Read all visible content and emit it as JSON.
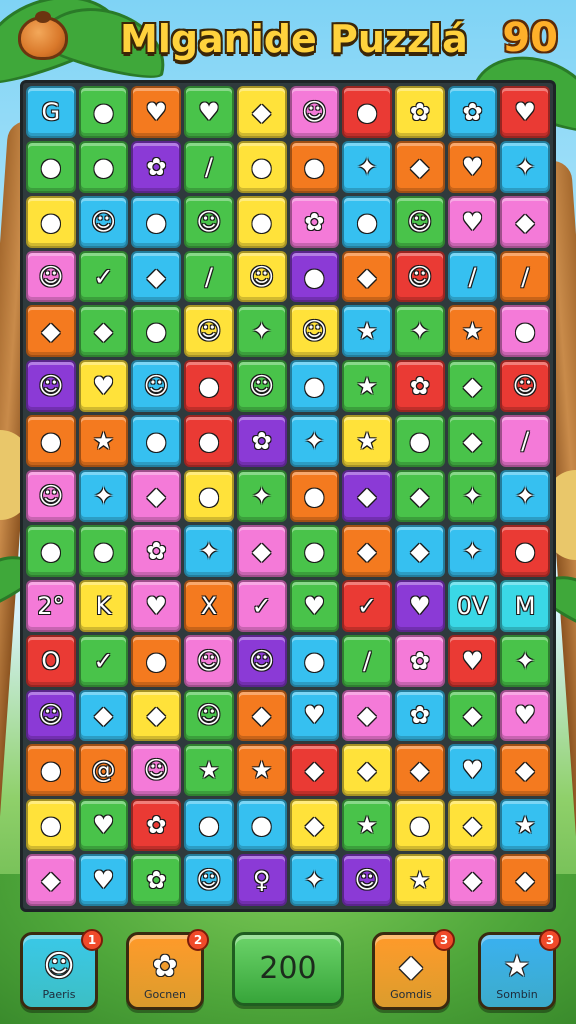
{
  "header": {
    "title": "Mlganide Puzzlá",
    "score": "90",
    "coconut_icon": "coconut-icon"
  },
  "palette": {
    "blue": "#36c0f0",
    "green": "#49c34a",
    "red": "#ea3a34",
    "orange": "#f47a1f",
    "yellow": "#ffe23a",
    "pink": "#f47ad8",
    "purple": "#8b3ad6",
    "magenta": "#e64ac8",
    "cyan": "#3ad8e6"
  },
  "board": {
    "rows": [
      [
        {
          "c": "blue",
          "g": "G"
        },
        {
          "c": "green",
          "g": "●"
        },
        {
          "c": "orange",
          "g": "♥"
        },
        {
          "c": "green",
          "g": "♥"
        },
        {
          "c": "yellow",
          "g": "◆"
        },
        {
          "c": "pink",
          "g": "☺"
        },
        {
          "c": "red",
          "g": "●"
        },
        {
          "c": "yellow",
          "g": "✿"
        },
        {
          "c": "blue",
          "g": "✿"
        },
        {
          "c": "red",
          "g": "♥"
        }
      ],
      [
        {
          "c": "green",
          "g": "●"
        },
        {
          "c": "green",
          "g": "●"
        },
        {
          "c": "purple",
          "g": "✿"
        },
        {
          "c": "green",
          "g": "/"
        },
        {
          "c": "yellow",
          "g": "●"
        },
        {
          "c": "orange",
          "g": "●"
        },
        {
          "c": "blue",
          "g": "✦"
        },
        {
          "c": "orange",
          "g": "◆"
        },
        {
          "c": "orange",
          "g": "♥"
        },
        {
          "c": "blue",
          "g": "✦"
        }
      ],
      [
        {
          "c": "yellow",
          "g": "●"
        },
        {
          "c": "blue",
          "g": "☺"
        },
        {
          "c": "blue",
          "g": "●"
        },
        {
          "c": "green",
          "g": "☺"
        },
        {
          "c": "yellow",
          "g": "●"
        },
        {
          "c": "pink",
          "g": "✿"
        },
        {
          "c": "blue",
          "g": "●"
        },
        {
          "c": "green",
          "g": "☺"
        },
        {
          "c": "pink",
          "g": "♥"
        },
        {
          "c": "pink",
          "g": "◆"
        }
      ],
      [
        {
          "c": "pink",
          "g": "☺"
        },
        {
          "c": "green",
          "g": "✓"
        },
        {
          "c": "blue",
          "g": "◆"
        },
        {
          "c": "green",
          "g": "/"
        },
        {
          "c": "yellow",
          "g": "☺"
        },
        {
          "c": "purple",
          "g": "●"
        },
        {
          "c": "orange",
          "g": "◆"
        },
        {
          "c": "red",
          "g": "☺"
        },
        {
          "c": "blue",
          "g": "/"
        },
        {
          "c": "orange",
          "g": "/"
        }
      ],
      [
        {
          "c": "orange",
          "g": "◆"
        },
        {
          "c": "green",
          "g": "◆"
        },
        {
          "c": "green",
          "g": "●"
        },
        {
          "c": "yellow",
          "g": "☺"
        },
        {
          "c": "green",
          "g": "✦"
        },
        {
          "c": "yellow",
          "g": "☺"
        },
        {
          "c": "blue",
          "g": "★"
        },
        {
          "c": "green",
          "g": "✦"
        },
        {
          "c": "orange",
          "g": "★"
        },
        {
          "c": "pink",
          "g": "●"
        }
      ],
      [
        {
          "c": "purple",
          "g": "☺"
        },
        {
          "c": "yellow",
          "g": "♥"
        },
        {
          "c": "blue",
          "g": "☺"
        },
        {
          "c": "red",
          "g": "●"
        },
        {
          "c": "green",
          "g": "☺"
        },
        {
          "c": "blue",
          "g": "●"
        },
        {
          "c": "green",
          "g": "★"
        },
        {
          "c": "red",
          "g": "✿"
        },
        {
          "c": "green",
          "g": "◆"
        },
        {
          "c": "red",
          "g": "☺"
        }
      ],
      [
        {
          "c": "orange",
          "g": "●"
        },
        {
          "c": "orange",
          "g": "★"
        },
        {
          "c": "blue",
          "g": "●"
        },
        {
          "c": "red",
          "g": "●"
        },
        {
          "c": "purple",
          "g": "✿"
        },
        {
          "c": "blue",
          "g": "✦"
        },
        {
          "c": "yellow",
          "g": "★"
        },
        {
          "c": "green",
          "g": "●"
        },
        {
          "c": "green",
          "g": "◆"
        },
        {
          "c": "pink",
          "g": "/"
        }
      ],
      [
        {
          "c": "pink",
          "g": "☺"
        },
        {
          "c": "blue",
          "g": "✦"
        },
        {
          "c": "pink",
          "g": "◆"
        },
        {
          "c": "yellow",
          "g": "●"
        },
        {
          "c": "green",
          "g": "✦"
        },
        {
          "c": "orange",
          "g": "●"
        },
        {
          "c": "purple",
          "g": "◆"
        },
        {
          "c": "green",
          "g": "◆"
        },
        {
          "c": "green",
          "g": "✦"
        },
        {
          "c": "blue",
          "g": "✦"
        }
      ],
      [
        {
          "c": "green",
          "g": "●"
        },
        {
          "c": "green",
          "g": "●"
        },
        {
          "c": "pink",
          "g": "✿"
        },
        {
          "c": "blue",
          "g": "✦"
        },
        {
          "c": "pink",
          "g": "◆"
        },
        {
          "c": "green",
          "g": "●"
        },
        {
          "c": "orange",
          "g": "◆"
        },
        {
          "c": "blue",
          "g": "◆"
        },
        {
          "c": "blue",
          "g": "✦"
        },
        {
          "c": "red",
          "g": "●"
        }
      ],
      [
        {
          "c": "pink",
          "g": "2°"
        },
        {
          "c": "yellow",
          "g": "K"
        },
        {
          "c": "pink",
          "g": "♥"
        },
        {
          "c": "orange",
          "g": "X"
        },
        {
          "c": "pink",
          "g": "✓"
        },
        {
          "c": "green",
          "g": "♥"
        },
        {
          "c": "red",
          "g": "✓"
        },
        {
          "c": "purple",
          "g": "♥"
        },
        {
          "c": "cyan",
          "g": "0V"
        },
        {
          "c": "cyan",
          "g": "M"
        }
      ],
      [
        {
          "c": "red",
          "g": "O"
        },
        {
          "c": "green",
          "g": "✓"
        },
        {
          "c": "orange",
          "g": "●"
        },
        {
          "c": "pink",
          "g": "☺"
        },
        {
          "c": "purple",
          "g": "☺"
        },
        {
          "c": "blue",
          "g": "●"
        },
        {
          "c": "green",
          "g": "/"
        },
        {
          "c": "pink",
          "g": "✿"
        },
        {
          "c": "red",
          "g": "♥"
        },
        {
          "c": "green",
          "g": "✦"
        }
      ],
      [
        {
          "c": "purple",
          "g": "☺"
        },
        {
          "c": "blue",
          "g": "◆"
        },
        {
          "c": "yellow",
          "g": "◆"
        },
        {
          "c": "green",
          "g": "☺"
        },
        {
          "c": "orange",
          "g": "◆"
        },
        {
          "c": "blue",
          "g": "♥"
        },
        {
          "c": "pink",
          "g": "◆"
        },
        {
          "c": "blue",
          "g": "✿"
        },
        {
          "c": "green",
          "g": "◆"
        },
        {
          "c": "pink",
          "g": "♥"
        }
      ],
      [
        {
          "c": "orange",
          "g": "●"
        },
        {
          "c": "orange",
          "g": "@"
        },
        {
          "c": "pink",
          "g": "☺"
        },
        {
          "c": "green",
          "g": "★"
        },
        {
          "c": "orange",
          "g": "★"
        },
        {
          "c": "red",
          "g": "◆"
        },
        {
          "c": "yellow",
          "g": "◆"
        },
        {
          "c": "orange",
          "g": "◆"
        },
        {
          "c": "blue",
          "g": "♥"
        },
        {
          "c": "orange",
          "g": "◆"
        }
      ],
      [
        {
          "c": "yellow",
          "g": "●"
        },
        {
          "c": "green",
          "g": "♥"
        },
        {
          "c": "red",
          "g": "✿"
        },
        {
          "c": "blue",
          "g": "●"
        },
        {
          "c": "blue",
          "g": "●"
        },
        {
          "c": "yellow",
          "g": "◆"
        },
        {
          "c": "green",
          "g": "★"
        },
        {
          "c": "yellow",
          "g": "●"
        },
        {
          "c": "yellow",
          "g": "◆"
        },
        {
          "c": "blue",
          "g": "★"
        }
      ],
      [
        {
          "c": "pink",
          "g": "◆"
        },
        {
          "c": "blue",
          "g": "♥"
        },
        {
          "c": "green",
          "g": "✿"
        },
        {
          "c": "blue",
          "g": "☺"
        },
        {
          "c": "purple",
          "g": "♀"
        },
        {
          "c": "blue",
          "g": "✦"
        },
        {
          "c": "purple",
          "g": "☺"
        },
        {
          "c": "yellow",
          "g": "★"
        },
        {
          "c": "pink",
          "g": "◆"
        },
        {
          "c": "orange",
          "g": "◆"
        }
      ]
    ]
  },
  "powerups": [
    {
      "label": "Paeris",
      "badge": "1",
      "icon": "☺",
      "icon_name": "character-icon",
      "color": "#3ac8e8"
    },
    {
      "label": "Gocnen",
      "badge": "2",
      "icon": "✿",
      "icon_name": "sheep-icon",
      "color": "#ff9a2a"
    },
    {
      "label": "Gomdis",
      "badge": "3",
      "icon": "◆",
      "icon_name": "gem-icon",
      "color": "#ff9a2a"
    },
    {
      "label": "Sombin",
      "badge": "3",
      "icon": "★",
      "icon_name": "star-icon",
      "color": "#3ab0f0"
    }
  ],
  "center_score": "200"
}
